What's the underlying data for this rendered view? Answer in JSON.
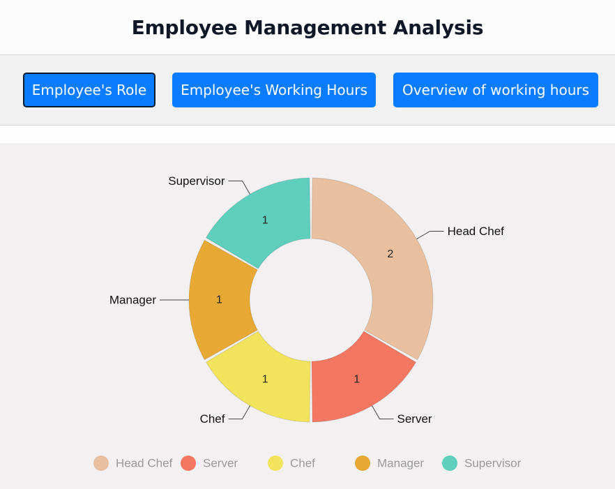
{
  "header": {
    "title": "Employee Management Analysis"
  },
  "tabs": [
    {
      "label": "Employee's Role",
      "active": true
    },
    {
      "label": "Employee's Working Hours",
      "active": false
    },
    {
      "label": "Overview of working hours",
      "active": false
    }
  ],
  "colors": {
    "accent": "#0a7cff",
    "panel_bg": "#f2f0f0"
  },
  "chart_data": {
    "type": "pie",
    "variant": "doughnut",
    "title": "",
    "categories": [
      "Head Chef",
      "Server",
      "Chef",
      "Manager",
      "Supervisor"
    ],
    "values": [
      2,
      1,
      1,
      1,
      1
    ],
    "colors": [
      "#e8c0a0",
      "#f47762",
      "#f2e35c",
      "#e8a834",
      "#5ecfbd"
    ],
    "legend": {
      "position": "bottom",
      "text_color": "#999999"
    }
  }
}
